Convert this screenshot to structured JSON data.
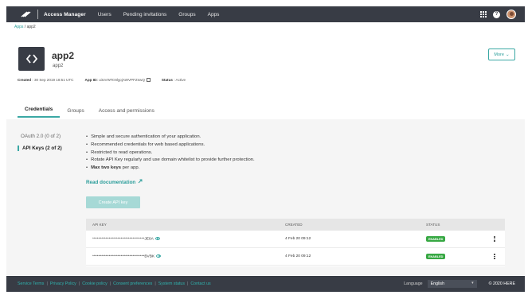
{
  "nav": {
    "brand": "Access Manager",
    "links": [
      "Users",
      "Pending invitations",
      "Groups",
      "Apps"
    ],
    "icons": [
      "apps-grid-icon",
      "help-icon",
      "avatar"
    ]
  },
  "breadcrumb": {
    "root": "Apps",
    "sep": " / ",
    "current": "app2"
  },
  "app": {
    "title": "app2",
    "subtitle": "app2",
    "more_label": "More",
    "meta": {
      "created_label": "Created",
      "created_value": ": 30 Sep 2019 18:51 UTC",
      "appid_label": "App ID:",
      "appid_value": "uiIoVWTcNlypjAWVPFZswQ",
      "status_label": "Status",
      "status_value": ": Active"
    }
  },
  "tabs": [
    "Credentials",
    "Groups",
    "Access and permissions"
  ],
  "sidebar": {
    "oauth": "OAuth 2.0 (0 of 2)",
    "apikeys": "API Keys (2 of 2)"
  },
  "content": {
    "bullets": [
      "Simple and secure authentication of your application.",
      "Recommended credentials for web based applications.",
      "Restricted to read operations.",
      "Rotate API Key regularly and use domain whitelist to provide further protection."
    ],
    "last_bullet_bold": "Max two keys",
    "last_bullet_rest": " per app.",
    "read_doc": "Read documentation",
    "create_btn": "Create API key"
  },
  "table": {
    "headers": [
      "API KEY",
      "CREATED",
      "STATUS"
    ],
    "rows": [
      {
        "key": "***********************************JE0A",
        "created": "4 Feb 20 09:12",
        "status": "ENABLED"
      },
      {
        "key": "***********************************BVBK",
        "created": "4 Feb 20 09:12",
        "status": "ENABLED"
      }
    ]
  },
  "footer": {
    "links": [
      "Service Terms",
      "Privacy Policy",
      "Cookie policy",
      "Consent preferences",
      "System status",
      "Contact us"
    ],
    "language_label": "Language",
    "language_value": "English",
    "copyright": "© 2020 HERE"
  },
  "colors": {
    "nav_bg": "#383c45",
    "accent": "#3aa8a4",
    "enabled": "#37a843"
  }
}
